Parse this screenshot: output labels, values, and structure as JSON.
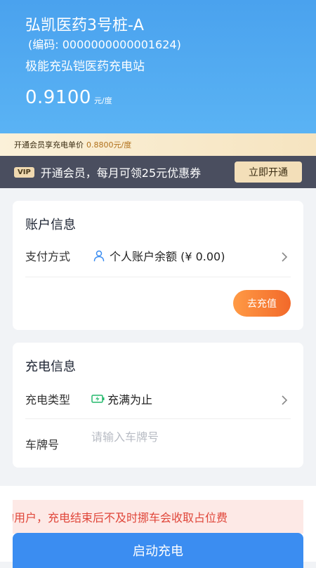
{
  "station": {
    "title": "弘凯医药3号桩-A",
    "code": "(编码: 0000000000001624)",
    "name": "极能充弘铠医药充电站",
    "price": "0.9100",
    "price_unit": "元/度"
  },
  "member_price": {
    "label": "开通会员享充电单价",
    "value": "0.8800元/度"
  },
  "vip": {
    "badge": "VIP",
    "text": "开通会员，每月可领25元优惠券",
    "button": "立即开通"
  },
  "account": {
    "title": "账户信息",
    "pay_label": "支付方式",
    "pay_value": "个人账户余额 (¥ 0.00)",
    "recharge_button": "去充值"
  },
  "charge": {
    "title": "充电信息",
    "type_label": "充电类型",
    "type_value": "充满为止",
    "plate_label": "车牌号",
    "plate_placeholder": "请输入车牌号",
    "plate_value": ""
  },
  "notice": {
    "text": "的用户，充电结束后不及时挪车会收取占位费"
  },
  "start_button": "启动充电",
  "colors": {
    "header_blue": "#4aa2ee",
    "accent_orange": "#f2692a",
    "start_blue": "#3b8df1",
    "notice_red": "#e0463a",
    "battery_green": "#23b96b"
  },
  "icons": {
    "pay": "person-icon",
    "charge_type": "battery-charging-icon",
    "row_arrow": "chevron-right-icon"
  }
}
